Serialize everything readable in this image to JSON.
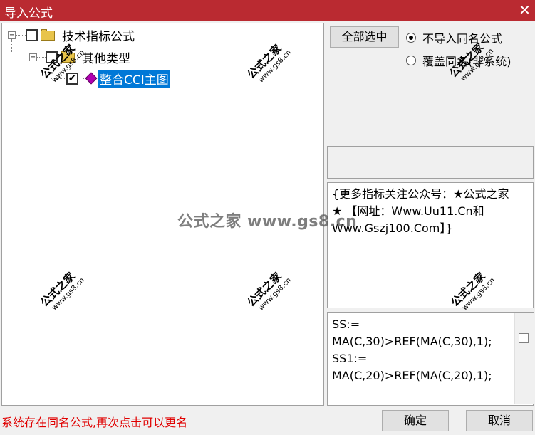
{
  "window": {
    "title": "导入公式",
    "close_glyph": "✕"
  },
  "tree": {
    "root": {
      "label": "技术指标公式",
      "expander": "−",
      "checked": false,
      "icon": "folder-icon"
    },
    "group": {
      "label": "其他类型",
      "expander": "−",
      "checked": false,
      "icon": "folder-icon"
    },
    "item": {
      "label": "整合CCI主图",
      "checked": true,
      "selected": true,
      "icon": "gem-icon"
    }
  },
  "controls": {
    "select_all_label": "全部选中",
    "radio_no_import_label": "不导入同名公式",
    "radio_overwrite_label": "覆盖同名(非系统)",
    "radio_selected": "no_import"
  },
  "description": "{更多指标关注公众号：★公式之家★ 【网址：Www.Uu11.Cn和Www.Gszj100.Com】}",
  "code": "SS:= MA(C,30)>REF(MA(C,30),1);\nSS1:= MA(C,20)>REF(MA(C,20),1);",
  "status": "系统存在同名公式,再次点击可以更名",
  "buttons": {
    "ok_label": "确定",
    "cancel_label": "取消"
  },
  "watermarks": {
    "brand": "公式之家",
    "site": "www.gs8.cn",
    "center": "公式之家 www.gs8.cn"
  },
  "colors": {
    "titlebar": "#ba2a31",
    "selection": "#0078d7",
    "status_text": "#e00000"
  }
}
